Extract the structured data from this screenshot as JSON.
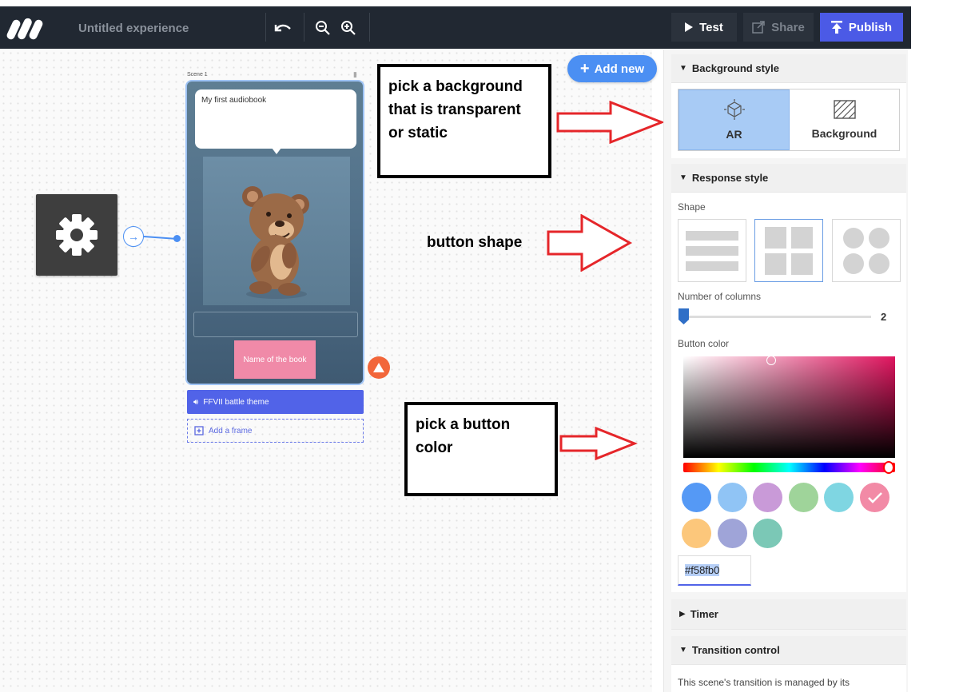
{
  "app": {
    "title": "Untitled experience"
  },
  "toolbar": {
    "undo_icon": "undo-icon",
    "zoom_out_icon": "zoom-out-icon",
    "zoom_in_icon": "zoom-in-icon",
    "test_label": "Test",
    "share_label": "Share",
    "publish_label": "Publish"
  },
  "canvas": {
    "add_new_label": "Add new",
    "scene_label": "Scene 1",
    "bubble_text": "My first audiobook",
    "answer_button_label": "Name of the book",
    "audio_label": "FFVII battle theme",
    "add_frame_label": "Add a frame"
  },
  "annotations": {
    "background_note": "pick a background that is transparent or static",
    "shape_note": "button shape",
    "color_note": "pick a button color"
  },
  "panel": {
    "background_style": {
      "title": "Background style",
      "options": [
        {
          "label": "AR",
          "icon": "ar-cube-icon",
          "selected": true
        },
        {
          "label": "Background",
          "icon": "background-pattern-icon",
          "selected": false
        }
      ]
    },
    "response_style": {
      "title": "Response style",
      "shape_label": "Shape",
      "shapes": [
        {
          "icon": "list-rows-icon",
          "selected": false
        },
        {
          "icon": "grid-squares-icon",
          "selected": true
        },
        {
          "icon": "grid-circles-icon",
          "selected": false
        }
      ],
      "columns_label": "Number of columns",
      "columns_value": "2",
      "button_color_label": "Button color",
      "swatches": [
        "#5599f5",
        "#90c4f5",
        "#c99ad8",
        "#9fd49a",
        "#7fd6e2",
        "#f28aa6",
        "#fcc77b",
        "#9fa4d8",
        "#7bc8b6"
      ],
      "selected_swatch_index": 5,
      "hex_value": "#f58fb0"
    },
    "timer": {
      "title": "Timer"
    },
    "transition_control": {
      "title": "Transition control",
      "text": "This scene's transition is managed by its"
    }
  },
  "colors": {
    "topbar": "#212832",
    "publish": "#4b5ae6",
    "accent": "#4b8ff3",
    "annotation_arrow": "#e5262a"
  }
}
